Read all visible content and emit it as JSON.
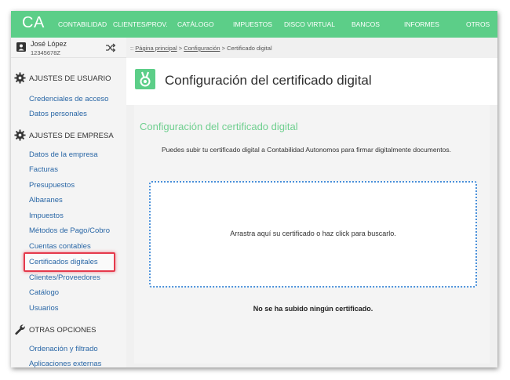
{
  "app": {
    "logo": "CA"
  },
  "nav": {
    "items": [
      "CONTABILIDAD",
      "CLIENTES/PROV.",
      "CATÁLOGO",
      "IMPUESTOS",
      "DISCO VIRTUAL",
      "BANCOS",
      "INFORMES",
      "OTROS"
    ]
  },
  "user": {
    "name": "José López",
    "id": "12345678Z"
  },
  "sidebar": {
    "sections": [
      {
        "label": "AJUSTES DE USUARIO",
        "icon": "gear-icon",
        "items": [
          "Credenciales de acceso",
          "Datos personales"
        ]
      },
      {
        "label": "AJUSTES DE EMPRESA",
        "icon": "gear-icon",
        "items": [
          "Datos de la empresa",
          "Facturas",
          "Presupuestos",
          "Albaranes",
          "Impuestos",
          "Métodos de Pago/Cobro",
          "Cuentas contables",
          "Certificados digitales",
          "Clientes/Proveedores",
          "Catálogo",
          "Usuarios"
        ]
      },
      {
        "label": "OTRAS OPCIONES",
        "icon": "wrench-icon",
        "items": [
          "Ordenación y filtrado",
          "Aplicaciones externas"
        ]
      }
    ],
    "active_item": "Certificados digitales"
  },
  "breadcrumb": {
    "prefix": "::",
    "home": "Página principal",
    "sep1": ">",
    "config": "Configuración",
    "sep2": ">",
    "current": "Certificado digital"
  },
  "page": {
    "title": "Configuración del certificado digital"
  },
  "panel": {
    "title": "Configuración del certificado digital",
    "description": "Puedes subir tu certificado digital a Contabilidad Autonomos para firmar digitalmente documentos.",
    "dropzone_text": "Arrastra aquí su certificado o haz click para buscarlo.",
    "status": "No se ha subido ningún certificado."
  },
  "colors": {
    "accent": "#5cce88",
    "link": "#2a67a6",
    "highlight": "#e53a4c",
    "dropzone_border": "#4a90d9"
  }
}
